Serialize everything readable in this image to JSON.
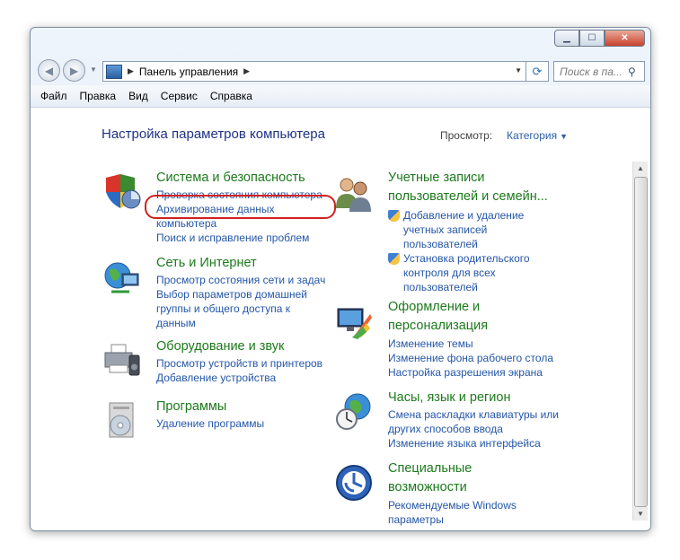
{
  "window": {
    "buttons": {
      "minimize": "▁",
      "maximize": "☐",
      "close": "✕"
    }
  },
  "nav": {
    "back": "◀",
    "forward": "▶",
    "address": "Панель управления",
    "search_placeholder": "Поиск в па..."
  },
  "menu": [
    "Файл",
    "Правка",
    "Вид",
    "Сервис",
    "Справка"
  ],
  "content": {
    "heading": "Настройка параметров компьютера",
    "view_label": "Просмотр:",
    "view_value": "Категория"
  },
  "left": [
    {
      "title": "Система и безопасность",
      "links": [
        "Проверка состояния компьютера",
        "Архивирование данных",
        "компьютера",
        "Поиск и исправление проблем"
      ]
    },
    {
      "title": "Сеть и Интернет",
      "links": [
        "Просмотр состояния сети и задач",
        "Выбор параметров домашней",
        "группы и общего доступа к",
        "данным"
      ]
    },
    {
      "title": "Оборудование и звук",
      "links": [
        "Просмотр устройств и принтеров",
        "Добавление устройства"
      ]
    },
    {
      "title": "Программы",
      "links": [
        "Удаление программы"
      ]
    }
  ],
  "right": [
    {
      "title": [
        "Учетные записи",
        "пользователей и семейн..."
      ],
      "links": [
        [
          "Добавление и удаление",
          "учетных записей",
          "пользователей"
        ],
        [
          "Установка родительского",
          "контроля для всех",
          "пользователей"
        ]
      ]
    },
    {
      "title": [
        "Оформление и",
        "персонализация"
      ],
      "links": [
        "Изменение темы",
        "Изменение фона рабочего стола",
        "Настройка разрешения экрана"
      ]
    },
    {
      "title": [
        "Часы, язык и регион"
      ],
      "links": [
        "Смена раскладки клавиатуры или",
        "других способов ввода",
        "Изменение языка интерфейса"
      ]
    },
    {
      "title": [
        "Специальные",
        "возможности"
      ],
      "links": [
        "Рекомендуемые Windows",
        "параметры"
      ]
    }
  ]
}
